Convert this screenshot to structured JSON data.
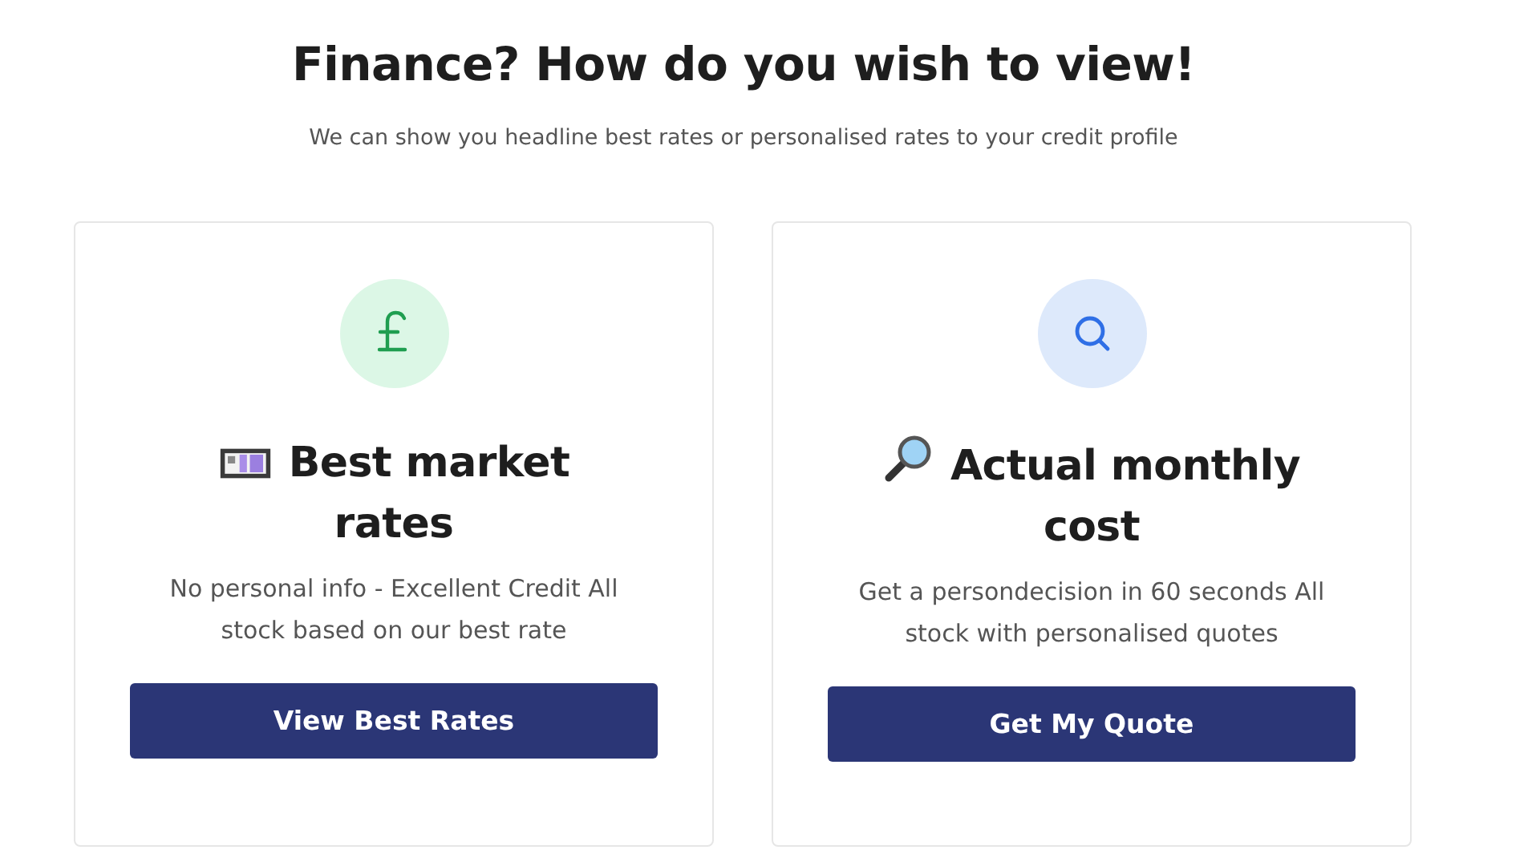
{
  "heading": "Finance? How do you wish to view!",
  "subheading": "We can show you headline best rates or personalised rates to your credit profile",
  "cards": [
    {
      "kind": "pound",
      "title": "Best market rates",
      "description": "No personal info - Excellent Credit All stock based on our best rate",
      "button": "View Best Rates"
    },
    {
      "kind": "search",
      "title": "Actual monthly cost",
      "description": "Get a persondecision in 60 seconds All stock with personalised quotes",
      "button": "Get My Quote"
    }
  ]
}
